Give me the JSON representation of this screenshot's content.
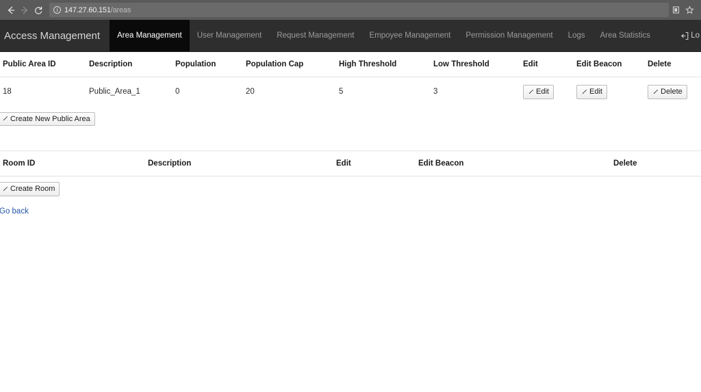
{
  "browser": {
    "back_icon": "back-arrow-icon",
    "forward_icon": "forward-arrow-icon",
    "reload_icon": "reload-icon",
    "info_icon": "info-icon",
    "url_host": "147.27.60.151",
    "url_path": "/areas",
    "cast_icon": "cast-icon",
    "bookmark_icon": "star-icon"
  },
  "navbar": {
    "brand": "Access Management",
    "items": [
      {
        "label": "Area Management",
        "active": true
      },
      {
        "label": "User Management",
        "active": false
      },
      {
        "label": "Request Management",
        "active": false
      },
      {
        "label": "Empoyee Management",
        "active": false
      },
      {
        "label": "Permission Management",
        "active": false
      },
      {
        "label": "Logs",
        "active": false
      },
      {
        "label": "Area Statistics",
        "active": false
      }
    ],
    "logout_label": "Lo"
  },
  "public_area_table": {
    "headers": [
      "Public Area ID",
      "Description",
      "Population",
      "Population Cap",
      "High Threshold",
      "Low Threshold",
      "Edit",
      "Edit Beacon",
      "Delete"
    ],
    "rows": [
      {
        "id": "18",
        "description": "Public_Area_1",
        "population": "0",
        "population_cap": "20",
        "high_threshold": "5",
        "low_threshold": "3",
        "edit_label": "Edit",
        "edit_beacon_label": "Edit",
        "delete_label": "Delete"
      }
    ],
    "create_label": "Create New Public Area"
  },
  "room_table": {
    "headers": [
      "Room ID",
      "Description",
      "Edit",
      "Edit Beacon",
      "Delete"
    ],
    "rows": [],
    "create_label": "Create Room"
  },
  "footer": {
    "go_back_label": "Go back"
  }
}
